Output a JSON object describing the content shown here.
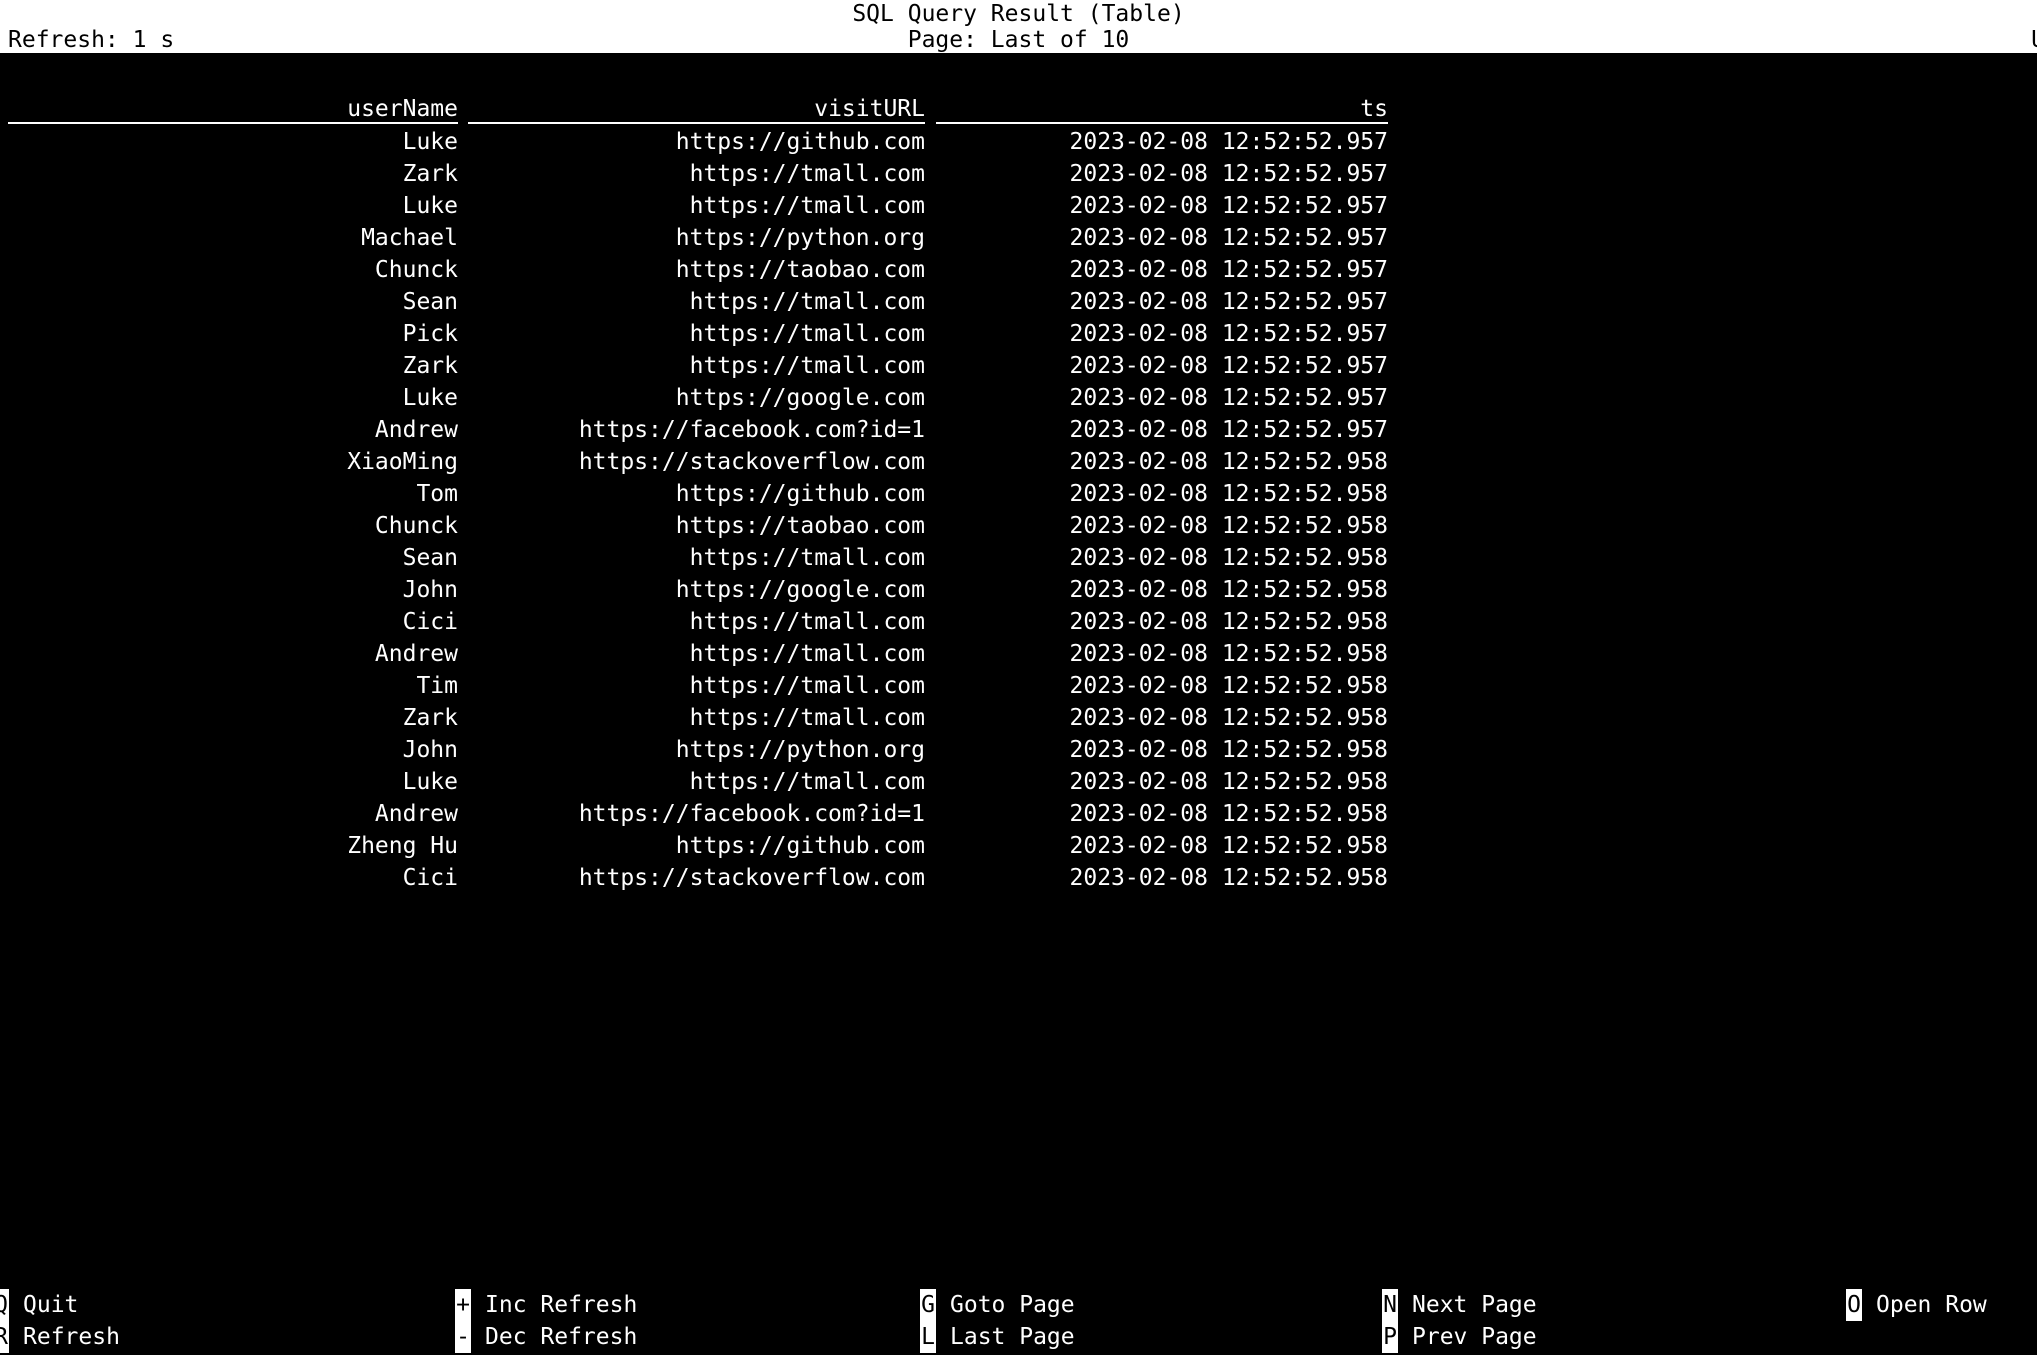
{
  "header": {
    "title": "SQL Query Result (Table)",
    "page_status": "Page: Last of 10",
    "refresh_label": "Refresh: 1 s",
    "right_edge_text": "U"
  },
  "table": {
    "columns": [
      {
        "key": "userName",
        "label": "userName"
      },
      {
        "key": "visitURL",
        "label": "visitURL"
      },
      {
        "key": "ts",
        "label": "ts"
      }
    ],
    "rows": [
      {
        "userName": "Luke",
        "visitURL": "https://github.com",
        "ts": "2023-02-08 12:52:52.957"
      },
      {
        "userName": "Zark",
        "visitURL": "https://tmall.com",
        "ts": "2023-02-08 12:52:52.957"
      },
      {
        "userName": "Luke",
        "visitURL": "https://tmall.com",
        "ts": "2023-02-08 12:52:52.957"
      },
      {
        "userName": "Machael",
        "visitURL": "https://python.org",
        "ts": "2023-02-08 12:52:52.957"
      },
      {
        "userName": "Chunck",
        "visitURL": "https://taobao.com",
        "ts": "2023-02-08 12:52:52.957"
      },
      {
        "userName": "Sean",
        "visitURL": "https://tmall.com",
        "ts": "2023-02-08 12:52:52.957"
      },
      {
        "userName": "Pick",
        "visitURL": "https://tmall.com",
        "ts": "2023-02-08 12:52:52.957"
      },
      {
        "userName": "Zark",
        "visitURL": "https://tmall.com",
        "ts": "2023-02-08 12:52:52.957"
      },
      {
        "userName": "Luke",
        "visitURL": "https://google.com",
        "ts": "2023-02-08 12:52:52.957"
      },
      {
        "userName": "Andrew",
        "visitURL": "https://facebook.com?id=1",
        "ts": "2023-02-08 12:52:52.957"
      },
      {
        "userName": "XiaoMing",
        "visitURL": "https://stackoverflow.com",
        "ts": "2023-02-08 12:52:52.958"
      },
      {
        "userName": "Tom",
        "visitURL": "https://github.com",
        "ts": "2023-02-08 12:52:52.958"
      },
      {
        "userName": "Chunck",
        "visitURL": "https://taobao.com",
        "ts": "2023-02-08 12:52:52.958"
      },
      {
        "userName": "Sean",
        "visitURL": "https://tmall.com",
        "ts": "2023-02-08 12:52:52.958"
      },
      {
        "userName": "John",
        "visitURL": "https://google.com",
        "ts": "2023-02-08 12:52:52.958"
      },
      {
        "userName": "Cici",
        "visitURL": "https://tmall.com",
        "ts": "2023-02-08 12:52:52.958"
      },
      {
        "userName": "Andrew",
        "visitURL": "https://tmall.com",
        "ts": "2023-02-08 12:52:52.958"
      },
      {
        "userName": "Tim",
        "visitURL": "https://tmall.com",
        "ts": "2023-02-08 12:52:52.958"
      },
      {
        "userName": "Zark",
        "visitURL": "https://tmall.com",
        "ts": "2023-02-08 12:52:52.958"
      },
      {
        "userName": "John",
        "visitURL": "https://python.org",
        "ts": "2023-02-08 12:52:52.958"
      },
      {
        "userName": "Luke",
        "visitURL": "https://tmall.com",
        "ts": "2023-02-08 12:52:52.958"
      },
      {
        "userName": "Andrew",
        "visitURL": "https://facebook.com?id=1",
        "ts": "2023-02-08 12:52:52.958"
      },
      {
        "userName": "Zheng Hu",
        "visitURL": "https://github.com",
        "ts": "2023-02-08 12:52:52.958"
      },
      {
        "userName": "Cici",
        "visitURL": "https://stackoverflow.com",
        "ts": "2023-02-08 12:52:52.958"
      }
    ]
  },
  "footer": {
    "columns": [
      {
        "items": [
          {
            "key": "Q",
            "label": "Quit"
          },
          {
            "key": "R",
            "label": "Refresh"
          }
        ]
      },
      {
        "items": [
          {
            "key": "+",
            "label": "Inc Refresh"
          },
          {
            "key": "-",
            "label": "Dec Refresh"
          }
        ]
      },
      {
        "items": [
          {
            "key": "G",
            "label": "Goto Page"
          },
          {
            "key": "L",
            "label": "Last Page"
          }
        ]
      },
      {
        "items": [
          {
            "key": "N",
            "label": "Next Page"
          },
          {
            "key": "P",
            "label": "Prev Page"
          }
        ]
      },
      {
        "items": [
          {
            "key": "O",
            "label": "Open Row"
          }
        ]
      }
    ]
  },
  "colors": {
    "background": "#000000",
    "foreground": "#ffffff",
    "header_background": "#ffffff",
    "header_foreground": "#000000"
  }
}
